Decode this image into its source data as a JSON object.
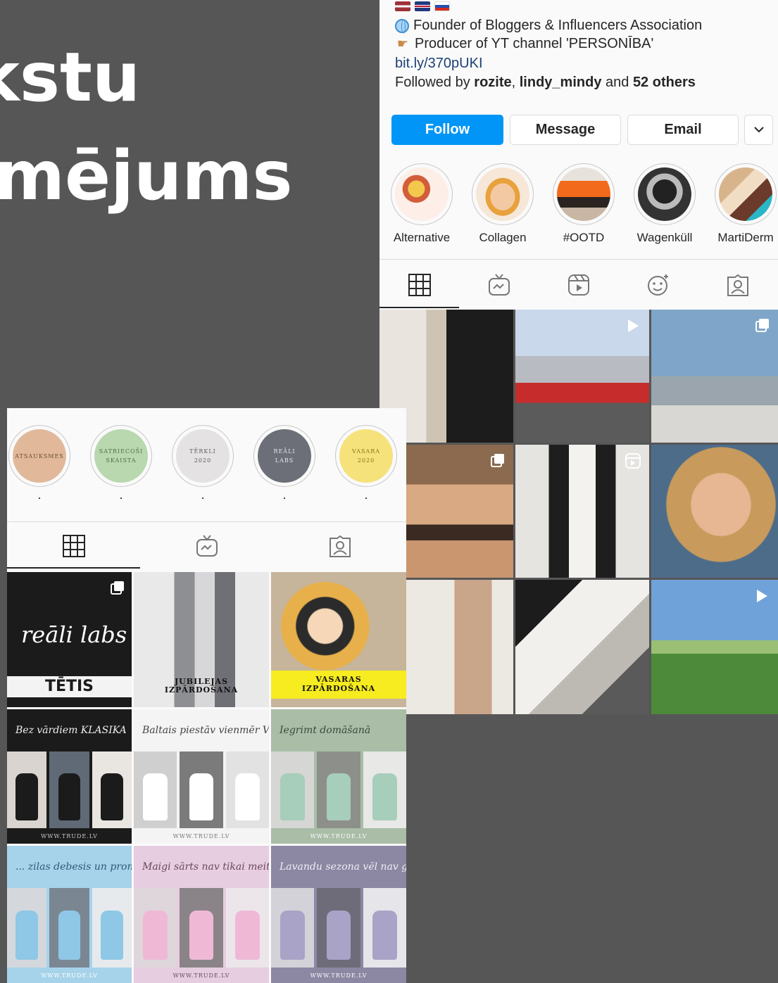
{
  "slide": {
    "title_line1": "kstu",
    "title_line2": "mējums"
  },
  "profile_right": {
    "bio_line1": "Founder of Bloggers & Influencers Association",
    "bio_line2": "Producer of YT channel 'PERSONĪBA'",
    "link": "bit.ly/370pUKI",
    "followed_prefix": "Followed by ",
    "followed_user1": "rozite",
    "followed_sep": ", ",
    "followed_user2": "lindy_mindy",
    "followed_and": " and ",
    "followed_others": "52 others",
    "buttons": {
      "follow": "Follow",
      "message": "Message",
      "email": "Email"
    },
    "highlights": [
      "Alternative",
      "Collagen",
      "#OOTD",
      "Wagenküll",
      "MartiDerm"
    ]
  },
  "profile_left": {
    "highlights": [
      {
        "line1": "ATSAUKSMES",
        "line2": ""
      },
      {
        "line1": "SATRIECOŠI",
        "line2": "SKAISTA"
      },
      {
        "line1": "TĒRKLI",
        "line2": "2020"
      },
      {
        "line1": "REĀLI",
        "line2": "LABS"
      },
      {
        "line1": "VASARA",
        "line2": "2020"
      }
    ],
    "posts": {
      "tetis": "TĒTIS",
      "jubilejas_1": "JUBILEJAS",
      "jubilejas_2": "IZPĀRDOŠANA",
      "vasaras_1": "VASARAS",
      "vasaras_2": "IZPĀRDOŠANA",
      "realilabs": "reāli labs",
      "banner1": "Bez vārdiem KLASIKA",
      "banner2": "Baltais piestāv vienmēr VIENMĒR",
      "banner3": "Iegrimt domāšanā",
      "banner4": "... zilas debesis un prom vasarā",
      "banner5": "Maigi sārts nav tikai meitenēm",
      "banner6": "Lavandu sezona vēl nav galā",
      "site": "WWW.TRUDE.LV"
    }
  },
  "colors": {
    "follow_blue": "#0095f6",
    "slide_bg": "#565656"
  }
}
